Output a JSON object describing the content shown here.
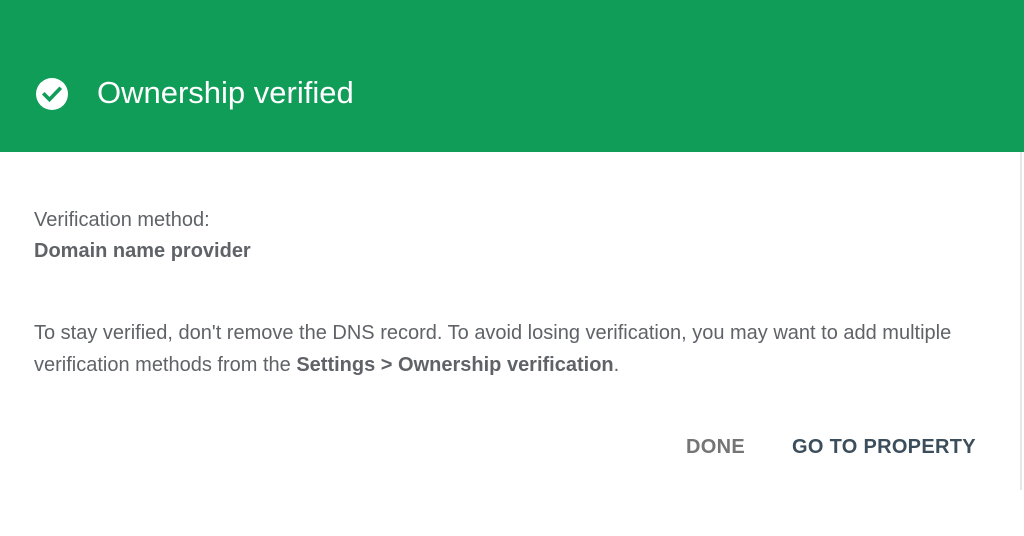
{
  "dialog": {
    "title": "Ownership verified",
    "header_icon": "check-circle-icon",
    "header_color": "#0f9d58",
    "method_label": "Verification method:",
    "method_value": "Domain name provider",
    "message_part1": "To stay verified, don't remove the DNS record. To avoid losing verification, you may want to add multiple verification methods from the ",
    "message_bold": "Settings > Ownership verification",
    "message_part2": ".",
    "buttons": {
      "done_label": "DONE",
      "go_to_property_label": "GO TO PROPERTY"
    }
  }
}
